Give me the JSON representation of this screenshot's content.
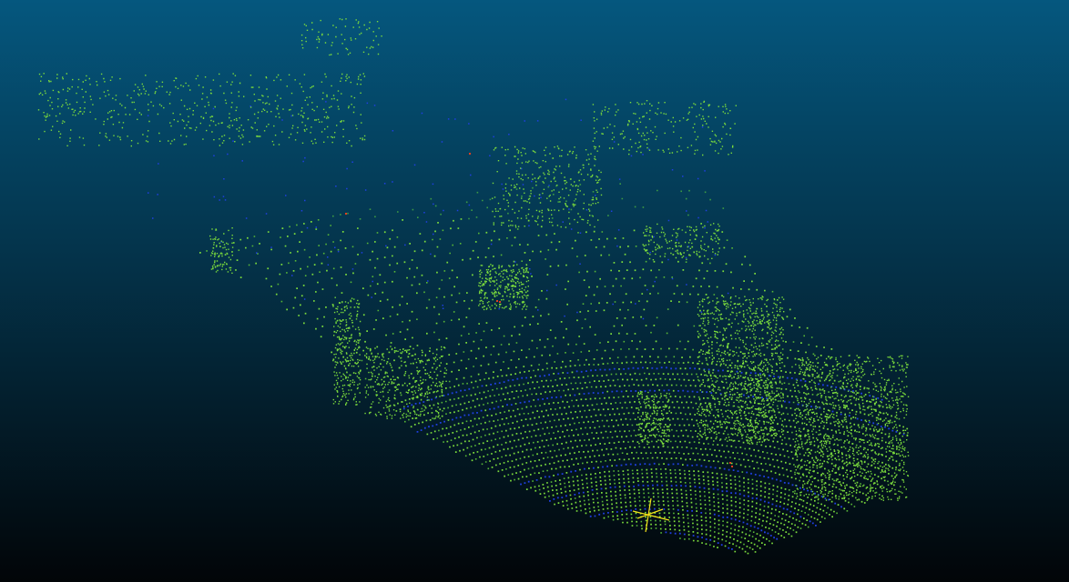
{
  "viewer": {
    "background_top_color": "#05577E",
    "background_bottom_color": "#020508",
    "ground_point_color": "#7BDB3C",
    "ground_point_dim_color": "#57B637",
    "far_point_color": "#3C9A45",
    "near_ring_color": "#1F3FE0",
    "highlight_point_color": "#E04020",
    "axis_marker_color": "#F2E11A",
    "icons": {
      "point_cloud": "point-cloud-icon",
      "axis_marker": "crosshair-icon"
    }
  }
}
